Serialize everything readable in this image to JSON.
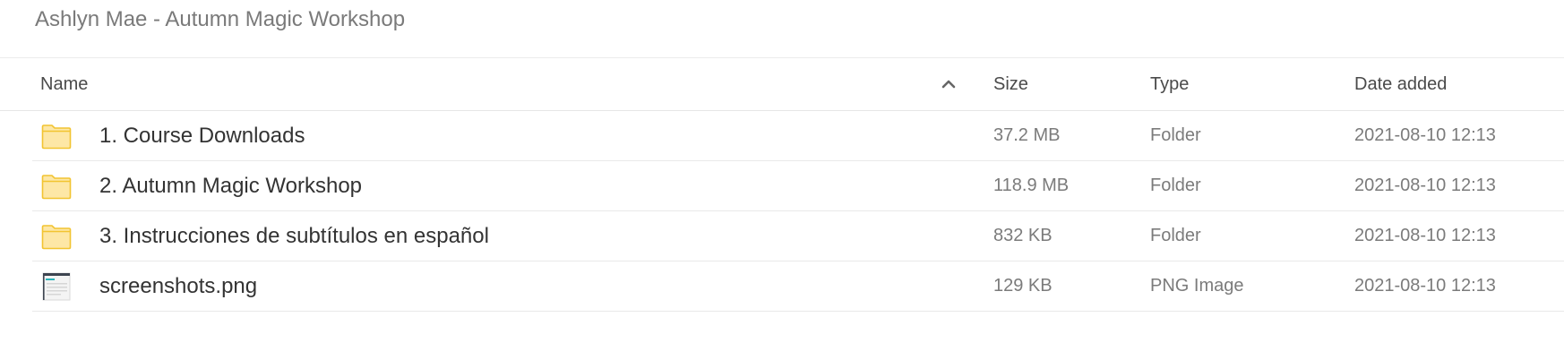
{
  "breadcrumb": "Ashlyn Mae - Autumn Magic Workshop",
  "columns": {
    "name": "Name",
    "size": "Size",
    "type": "Type",
    "date_added": "Date added"
  },
  "sort": {
    "column": "name",
    "direction": "ascending",
    "icon": "chevron-up-icon"
  },
  "files": [
    {
      "name": "1. Course Downloads",
      "size": "37.2 MB",
      "type": "Folder",
      "date_added": "2021-08-10 12:13",
      "icon": "folder-icon"
    },
    {
      "name": "2. Autumn Magic Workshop",
      "size": "118.9 MB",
      "type": "Folder",
      "date_added": "2021-08-10 12:13",
      "icon": "folder-icon"
    },
    {
      "name": "3. Instrucciones de subtítulos en español",
      "size": "832 KB",
      "type": "Folder",
      "date_added": "2021-08-10 12:13",
      "icon": "folder-icon"
    },
    {
      "name": "screenshots.png",
      "size": "129 KB",
      "type": "PNG Image",
      "date_added": "2021-08-10 12:13",
      "icon": "image-file-icon"
    }
  ],
  "colors": {
    "folder_fill": "#fde7a6",
    "folder_stroke": "#f2c431"
  }
}
